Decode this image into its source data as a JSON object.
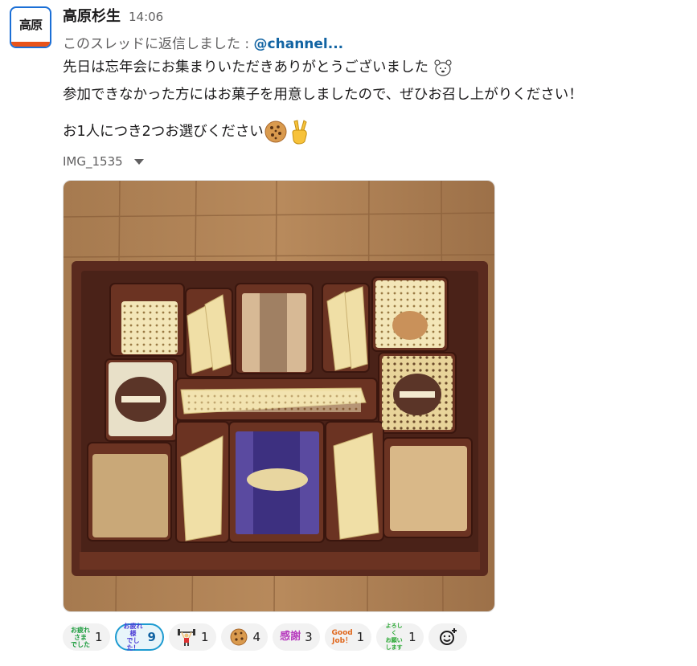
{
  "avatar": {
    "text": "高原"
  },
  "sender": {
    "name": "高原杉生",
    "time": "14:06"
  },
  "thread": {
    "prefix": "このスレッドに返信しました : ",
    "mention": "@channel..."
  },
  "message": {
    "line1": "先日は忘年会にお集まりいただきありがとうございました",
    "line2": "参加できなかった方にはお菓子を用意しましたので、ぜひお召し上がりください！",
    "line3": "お1人につき2つお選びください"
  },
  "file": {
    "name": "IMG_1535"
  },
  "reactions": [
    {
      "emoji_label": "お疲れさまでした",
      "emoji_lines": [
        "お疲れさま",
        "でした"
      ],
      "color": "#1a9b3c",
      "count": "1",
      "active": false
    },
    {
      "emoji_label": "お疲れ様でした！",
      "emoji_lines": [
        "お疲れ様",
        "でした！"
      ],
      "color": "#4a3bd6",
      "count": "9",
      "active": true
    },
    {
      "emoji_label": "weightlifter",
      "count": "1",
      "active": false
    },
    {
      "emoji_label": "cookie",
      "count": "4",
      "active": false
    },
    {
      "emoji_label": "感謝",
      "emoji_lines": [
        "感謝"
      ],
      "color": "#b83fbf",
      "count": "3",
      "active": false
    },
    {
      "emoji_label": "Good Job！",
      "emoji_lines": [
        "Good",
        "Job！"
      ],
      "color": "#e0681e",
      "count": "1",
      "active": false
    },
    {
      "emoji_label": "よろしくお願いします",
      "emoji_lines": [
        "よろしく",
        "お願いします"
      ],
      "color": "#2aa834",
      "count": "1",
      "active": false
    }
  ],
  "colors": {
    "mention": "#1264a3",
    "active_reaction_border": "#1d9bd1",
    "avatar_accent": "#e8531a"
  }
}
